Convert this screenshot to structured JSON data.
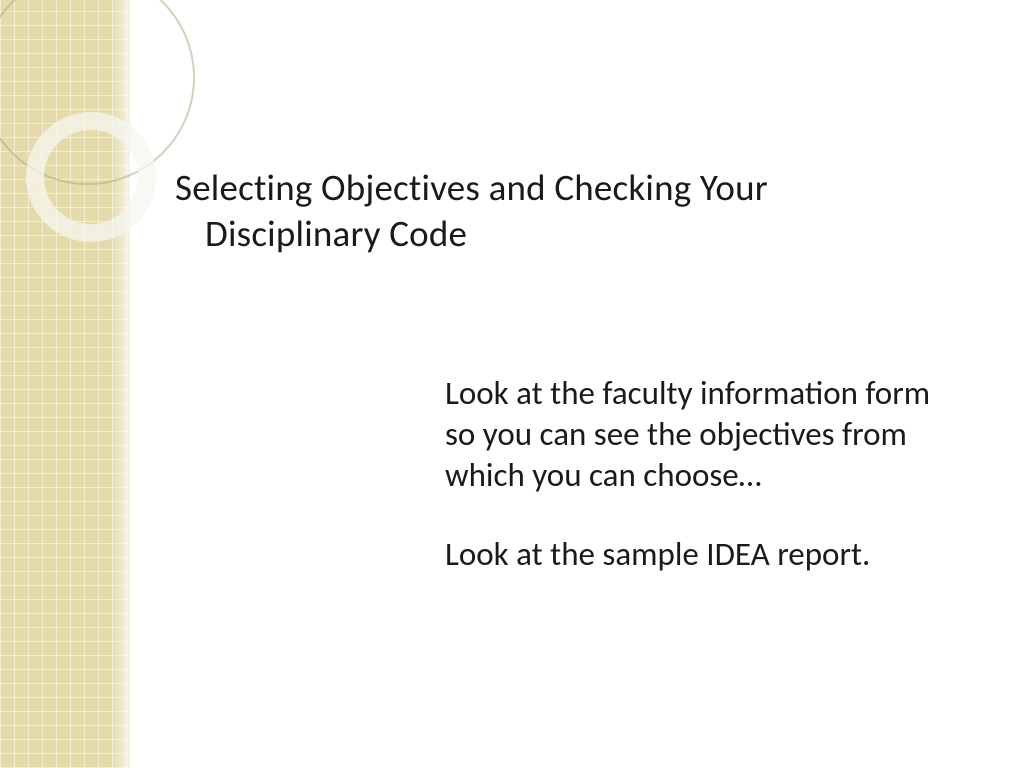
{
  "slide": {
    "title_line1": "Selecting Objectives and Checking Your",
    "title_line2": "Disciplinary Code",
    "body_p1": "Look at  the faculty information form so you can see the objectives from which you can choose…",
    "body_p2": "Look at the sample IDEA report."
  }
}
